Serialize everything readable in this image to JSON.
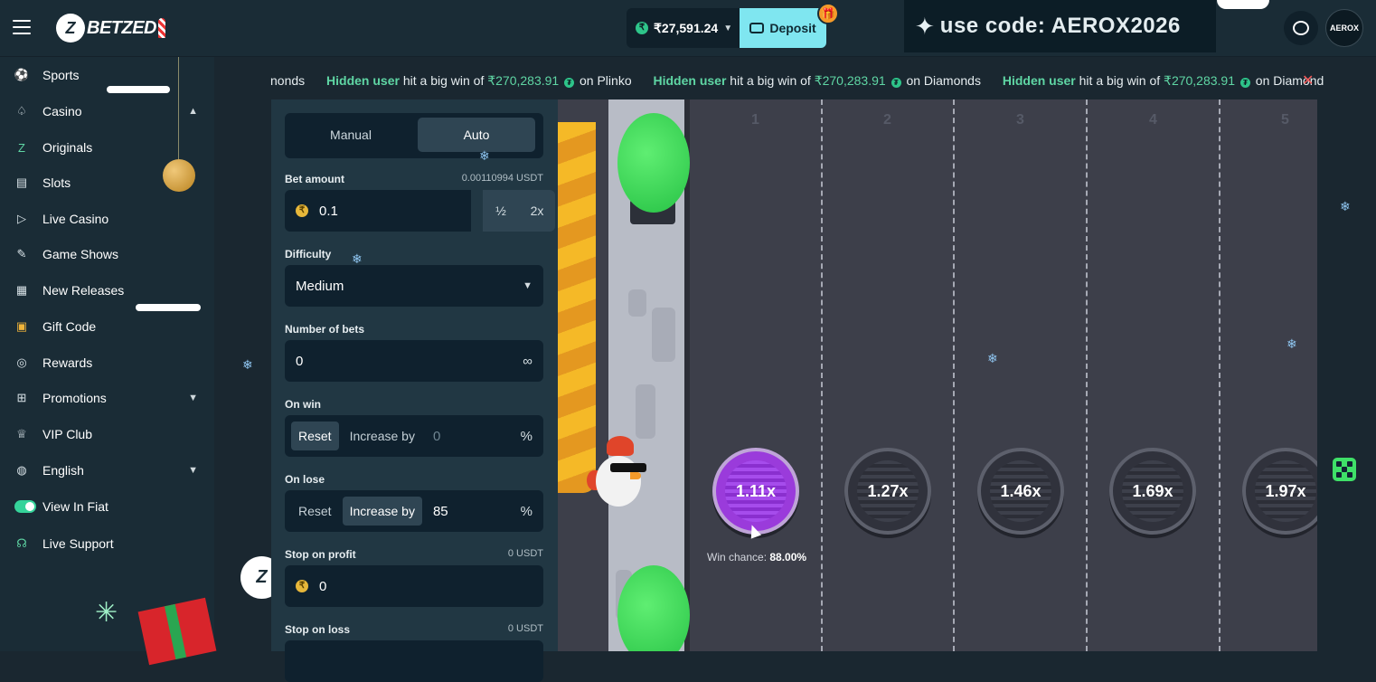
{
  "header": {
    "logo_text": "BETZED",
    "balance": "₹27,591.24",
    "deposit_label": "Deposit",
    "promo_text": "use code: AEROX2026",
    "avatar_text": "AEROX",
    "colors": {
      "deposit": "#7fe6f0",
      "accent_green": "#2ec58a"
    }
  },
  "sidebar": {
    "items": [
      {
        "label": "Sports",
        "icon": "sports-ball-icon"
      },
      {
        "label": "Casino",
        "icon": "casino-chip-icon",
        "chevron": "up"
      },
      {
        "label": "Originals",
        "icon": "originals-logo-icon"
      },
      {
        "label": "Slots",
        "icon": "slot-machine-icon"
      },
      {
        "label": "Live Casino",
        "icon": "live-casino-icon"
      },
      {
        "label": "Game Shows",
        "icon": "game-shows-icon"
      },
      {
        "label": "New Releases",
        "icon": "new-releases-icon"
      },
      {
        "label": "Gift Code",
        "icon": "gift-icon"
      },
      {
        "label": "Rewards",
        "icon": "rewards-icon"
      },
      {
        "label": "Promotions",
        "icon": "promotions-icon",
        "chevron": "down"
      },
      {
        "label": "VIP Club",
        "icon": "crown-icon"
      },
      {
        "label": "English",
        "icon": "globe-icon",
        "chevron": "down"
      },
      {
        "label": "View In Fiat",
        "icon": "toggle-icon",
        "toggle": true
      },
      {
        "label": "Live Support",
        "icon": "headset-icon"
      }
    ]
  },
  "ticker": {
    "lead_fragment": "nonds",
    "messages": [
      {
        "user": "Hidden user",
        "text": "hit a big win of",
        "amount": "₹270,283.91",
        "game_prefix": "on",
        "game": "Plinko"
      },
      {
        "user": "Hidden user",
        "text": "hit a big win of",
        "amount": "₹270,283.91",
        "game_prefix": "on",
        "game": "Diamonds"
      },
      {
        "user": "Hidden user",
        "text": "hit a big win of",
        "amount": "₹270,283.91",
        "game_prefix": "on",
        "game": "Diamond"
      }
    ]
  },
  "bet_panel": {
    "tabs": {
      "manual": "Manual",
      "auto": "Auto",
      "active": "Auto"
    },
    "bet_amount": {
      "label": "Bet amount",
      "usdt": "0.00110994 USDT",
      "value": "0.1",
      "half": "½",
      "double": "2x"
    },
    "difficulty": {
      "label": "Difficulty",
      "value": "Medium"
    },
    "number_of_bets": {
      "label": "Number of bets",
      "value": "0",
      "infinite": "∞"
    },
    "on_win": {
      "label": "On win",
      "reset": "Reset",
      "increase": "Increase by",
      "value": "0",
      "unit": "%",
      "active": "Reset"
    },
    "on_lose": {
      "label": "On lose",
      "reset": "Reset",
      "increase": "Increase by",
      "value": "85",
      "unit": "%",
      "active": "Increase by"
    },
    "stop_on_profit": {
      "label": "Stop on profit",
      "usdt": "0 USDT",
      "value": "0"
    },
    "stop_on_loss": {
      "label": "Stop on loss",
      "usdt": "0 USDT"
    }
  },
  "game": {
    "lanes": [
      "1",
      "2",
      "3",
      "4",
      "5"
    ],
    "multipliers": [
      "1.11x",
      "1.27x",
      "1.46x",
      "1.69x",
      "1.97x"
    ],
    "active_index": 0,
    "win_chance_label": "Win chance:",
    "win_chance_value": "88.00%",
    "colors": {
      "active_manhole": "#9a3bdb",
      "road": "#3d3f4a"
    }
  }
}
